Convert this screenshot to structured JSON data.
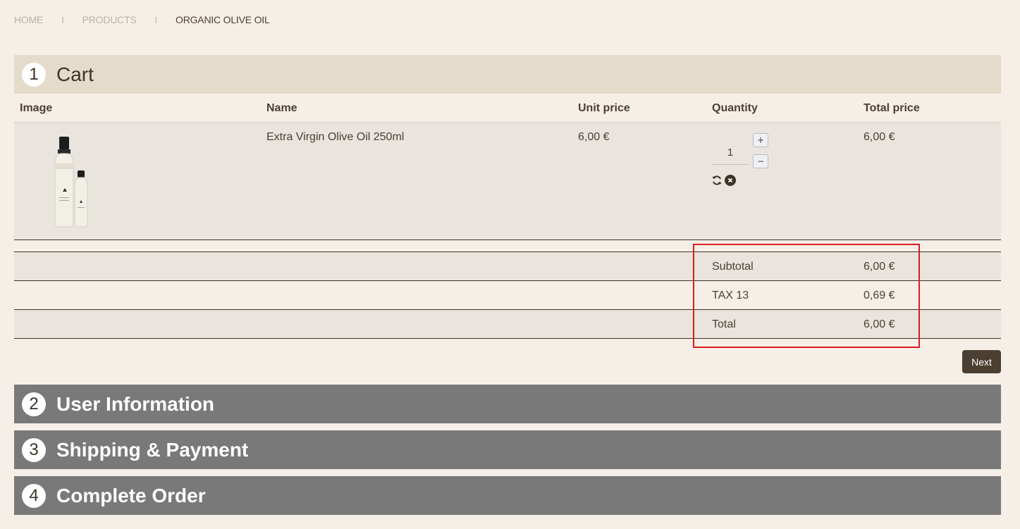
{
  "breadcrumb": {
    "items": [
      "HOME",
      "PRODUCTS",
      "ORGANIC OLIVE OIL"
    ],
    "separator": "I"
  },
  "steps": [
    {
      "number": "1",
      "title": "Cart"
    },
    {
      "number": "2",
      "title": "User Information"
    },
    {
      "number": "3",
      "title": "Shipping & Payment"
    },
    {
      "number": "4",
      "title": "Complete Order"
    }
  ],
  "cart": {
    "columns": [
      "Image",
      "Name",
      "Unit price",
      "Quantity",
      "Total price"
    ],
    "items": [
      {
        "image_icon": "olive-oil-bottles",
        "name": "Extra Virgin Olive Oil 250ml",
        "unit_price": "6,00 €",
        "quantity": "1",
        "total_price": "6,00 €"
      }
    ],
    "qty_plus": "+",
    "qty_minus": "−",
    "refresh_icon": "refresh-icon",
    "remove_icon": "remove-icon"
  },
  "summary": [
    {
      "label": "Subtotal",
      "value": "6,00 €"
    },
    {
      "label": "TAX 13",
      "value": "0,69 €"
    },
    {
      "label": "Total",
      "value": "6,00 €"
    }
  ],
  "next_label": "Next",
  "colors": {
    "background": "#f6efe8",
    "active_step": "#e4dbcb",
    "inactive_step": "#797979",
    "row_shade": "#e9e4dd",
    "highlight": "#e01b1b",
    "button": "#4a3f30"
  }
}
